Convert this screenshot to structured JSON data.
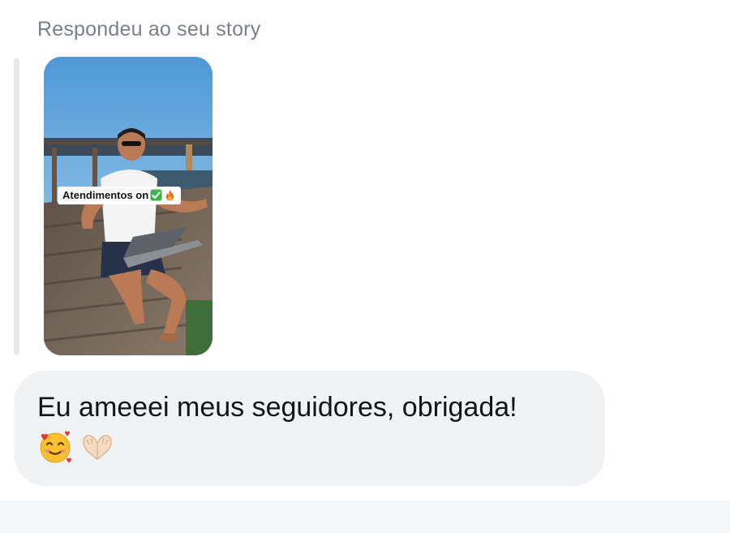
{
  "reply_context": {
    "caption": "Respondeu ao seu story"
  },
  "story": {
    "sticker_text": "Atendimentos on",
    "sticker_emojis": [
      "check-mark-button-icon",
      "fire-icon"
    ],
    "image": "story-photo"
  },
  "message": {
    "text": "Eu ameeei meus seguidores, obrigada!",
    "emojis": [
      "smiling-face-with-hearts-icon",
      "heart-hands-icon"
    ]
  },
  "colors": {
    "caption": "#7b7f86",
    "bubble": "#f1f2f4",
    "reply_bar": "#e6e8eb",
    "text": "#111418"
  }
}
